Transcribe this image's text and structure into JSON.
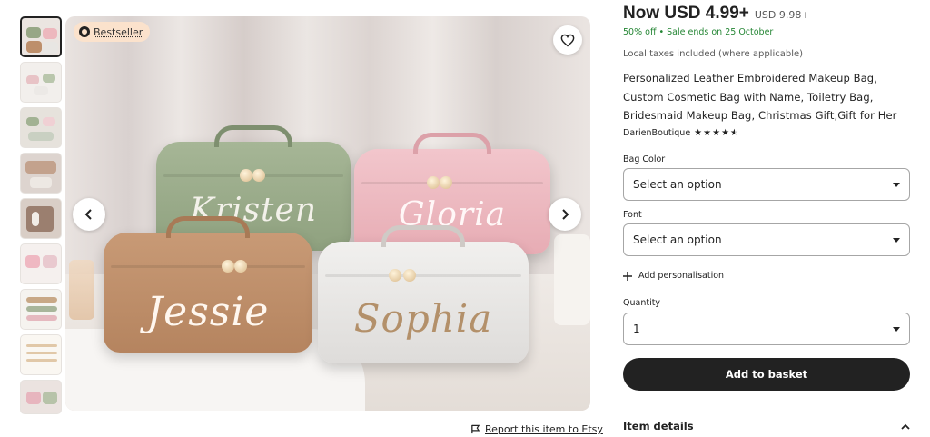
{
  "gallery": {
    "badge_label": "Bestseller",
    "bag_names": [
      "Kristen",
      "Gloria",
      "Jessie",
      "Sophia"
    ],
    "report_label": "Report this item to Etsy"
  },
  "product": {
    "price": "Now USD 4.99+",
    "old_price": "USD 9.98+",
    "sale_text": "50% off  •  Sale ends on 25 October",
    "taxes": "Local taxes included (where applicable)",
    "title": "Personalized Leather Embroidered Makeup Bag, Custom Cosmetic Bag with Name, Toiletry Bag, Bridesmaid Makeup Bag, Christmas Gift,Gift for Her",
    "shop_name": "DarienBoutique",
    "rating": 4.5
  },
  "options": {
    "bag_color_label": "Bag Color",
    "bag_color_value": "Select an option",
    "font_label": "Font",
    "font_value": "Select an option",
    "add_personalisation": "Add personalisation",
    "quantity_label": "Quantity",
    "quantity_value": "1"
  },
  "actions": {
    "add_to_basket": "Add to basket",
    "item_details": "Item details"
  },
  "colors": {
    "sale_green": "#258635",
    "badge_bg": "#fbe2cc",
    "button_dark": "#222222"
  }
}
